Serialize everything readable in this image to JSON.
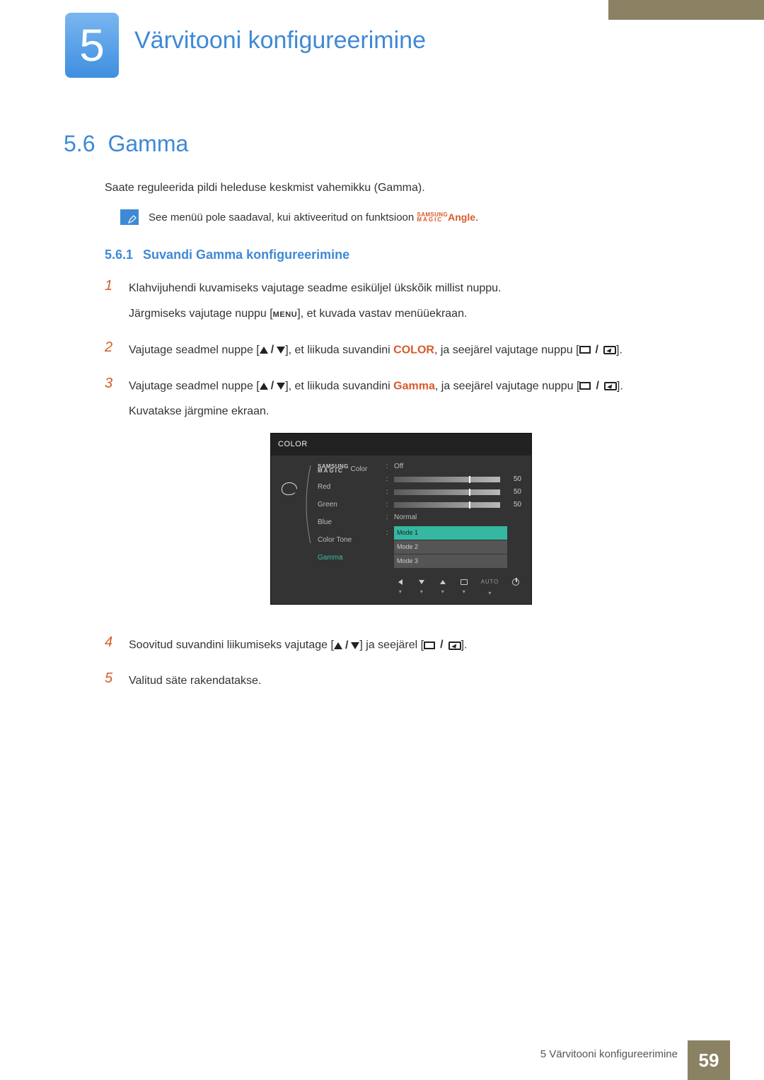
{
  "chapter": {
    "number": "5",
    "title": "Värvitooni konfigureerimine"
  },
  "section": {
    "number": "5.6",
    "title": "Gamma"
  },
  "intro": "Saate reguleerida pildi heleduse keskmist vahemikku (Gamma).",
  "note": {
    "prefix": "See menüü pole saadaval, kui aktiveeritud on funktsioon ",
    "samsung_top": "SAMSUNG",
    "samsung_bottom": "MAGIC",
    "angle": "Angle",
    "suffix": "."
  },
  "subsection": {
    "number": "5.6.1",
    "title": "Suvandi Gamma konfigureerimine"
  },
  "steps": {
    "s1a": "Klahvijuhendi kuvamiseks vajutage seadme esiküljel ükskõik millist nuppu.",
    "s1b_pre": "Järgmiseks vajutage nuppu [",
    "s1b_menu": "MENU",
    "s1b_post": "], et kuvada vastav menüüekraan.",
    "s2_pre": "Vajutage seadmel nuppe [",
    "s2_mid": "], et liikuda suvandini ",
    "s2_kw": "COLOR",
    "s2_post1": ", ja seejärel vajutage nuppu [",
    "s2_post2": "].",
    "s3_pre": "Vajutage seadmel nuppe [",
    "s3_mid": "], et liikuda suvandini ",
    "s3_kw": "Gamma",
    "s3_post1": ", ja seejärel vajutage nuppu [",
    "s3_post2": "].",
    "s3_line2": "Kuvatakse järgmine ekraan.",
    "s4_pre": "Soovitud suvandini liikumiseks vajutage [",
    "s4_mid": "] ja seejärel [",
    "s4_post": "].",
    "s5": "Valitud säte rakendatakse."
  },
  "osd": {
    "title": "COLOR",
    "items": [
      {
        "label_top": "SAMSUNG",
        "label_bottom": "MAGIC",
        "label_suffix": " Color",
        "value": "Off"
      },
      {
        "label": "Red",
        "num": "50"
      },
      {
        "label": "Green",
        "num": "50"
      },
      {
        "label": "Blue",
        "num": "50"
      },
      {
        "label": "Color Tone",
        "value": "Normal"
      },
      {
        "label": "Gamma",
        "hl": true
      }
    ],
    "gamma_modes": [
      "Mode 1",
      "Mode 2",
      "Mode 3"
    ],
    "auto": "AUTO"
  },
  "footer": {
    "text": "5 Värvitooni konfigureerimine",
    "page": "59"
  }
}
